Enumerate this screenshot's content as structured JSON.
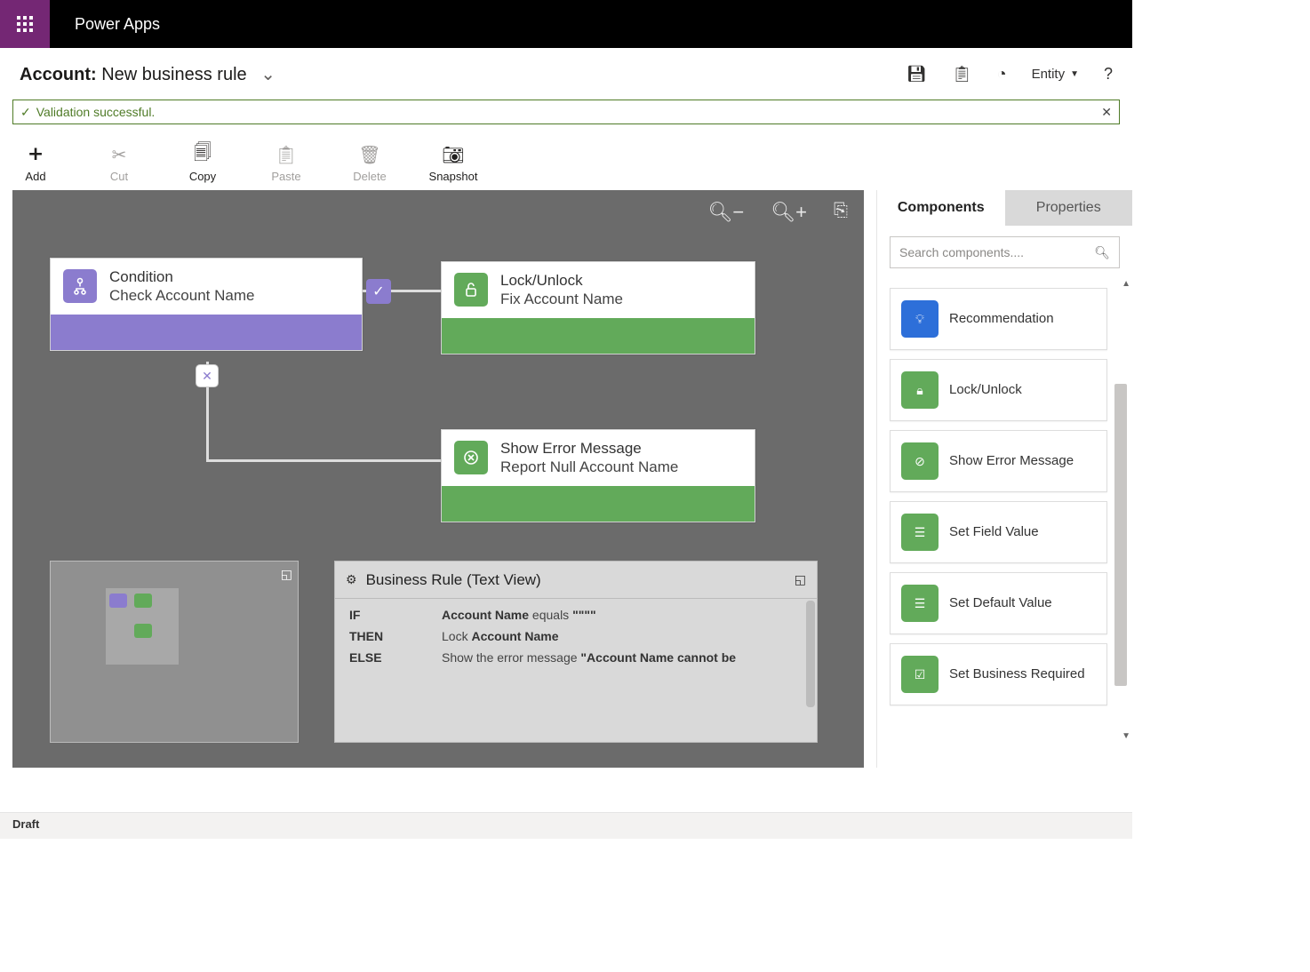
{
  "topbar": {
    "app_name": "Power Apps"
  },
  "header": {
    "prefix": "Account:",
    "title": "New business rule",
    "actions": {
      "entity_label": "Entity"
    }
  },
  "notice": {
    "message": "Validation successful."
  },
  "toolbar": {
    "add": "Add",
    "cut": "Cut",
    "copy": "Copy",
    "paste": "Paste",
    "delete": "Delete",
    "snapshot": "Snapshot"
  },
  "nodes": {
    "condition": {
      "title": "Condition",
      "subtitle": "Check Account Name"
    },
    "lock": {
      "title": "Lock/Unlock",
      "subtitle": "Fix Account Name"
    },
    "error": {
      "title": "Show Error Message",
      "subtitle": "Report Null Account Name"
    }
  },
  "textview": {
    "title": "Business Rule (Text View)",
    "rows": {
      "if": {
        "label": "IF",
        "field1": "Account Name",
        "op": "equals",
        "val": "\"\"\"\""
      },
      "then": {
        "label": "THEN",
        "pre": "Lock ",
        "field": "Account Name"
      },
      "else": {
        "label": "ELSE",
        "pre": "Show the error message ",
        "msg": "\"Account Name cannot be"
      }
    }
  },
  "side": {
    "tabs": {
      "components": "Components",
      "properties": "Properties"
    },
    "search_placeholder": "Search components....",
    "components": {
      "recommendation": "Recommendation",
      "lock_unlock": "Lock/Unlock",
      "show_error": "Show Error Message",
      "set_field": "Set Field Value",
      "set_default": "Set Default Value",
      "set_required": "Set Business Required"
    }
  },
  "footer": {
    "status": "Draft"
  },
  "colors": {
    "purple": "#8b7cce",
    "green": "#62aa5a",
    "blue": "#2d6fd9"
  }
}
